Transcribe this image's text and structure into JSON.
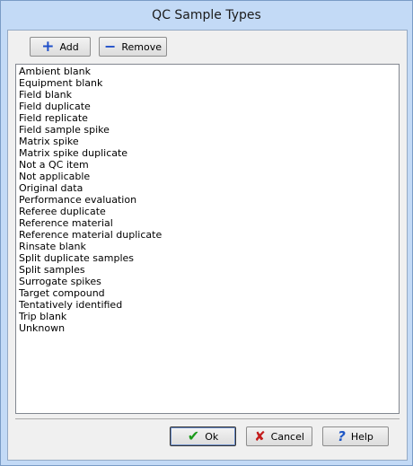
{
  "window": {
    "title": "QC Sample Types"
  },
  "toolbar": {
    "add_label": "Add",
    "remove_label": "Remove",
    "add_icon": "plus-icon",
    "remove_icon": "minus-icon"
  },
  "list": {
    "items": [
      "Ambient blank",
      "Equipment blank",
      "Field blank",
      "Field duplicate",
      "Field replicate",
      "Field sample spike",
      "Matrix spike",
      "Matrix spike duplicate",
      "Not a QC item",
      "Not applicable",
      "Original data",
      "Performance evaluation",
      "Referee duplicate",
      "Reference material",
      "Reference material duplicate",
      "Rinsate blank",
      "Split duplicate samples",
      "Split samples",
      "Surrogate spikes",
      "Target compound",
      "Tentatively identified",
      "Trip blank",
      "Unknown"
    ]
  },
  "footer": {
    "ok_label": "Ok",
    "cancel_label": "Cancel",
    "help_label": "Help",
    "ok_icon": "checkmark-icon",
    "cancel_icon": "x-icon",
    "help_icon": "question-icon"
  },
  "colors": {
    "frame": "#c3daf6",
    "accent_blue": "#1f4fc9",
    "ok_green": "#1a9a1a",
    "cancel_red": "#c31c1c"
  }
}
